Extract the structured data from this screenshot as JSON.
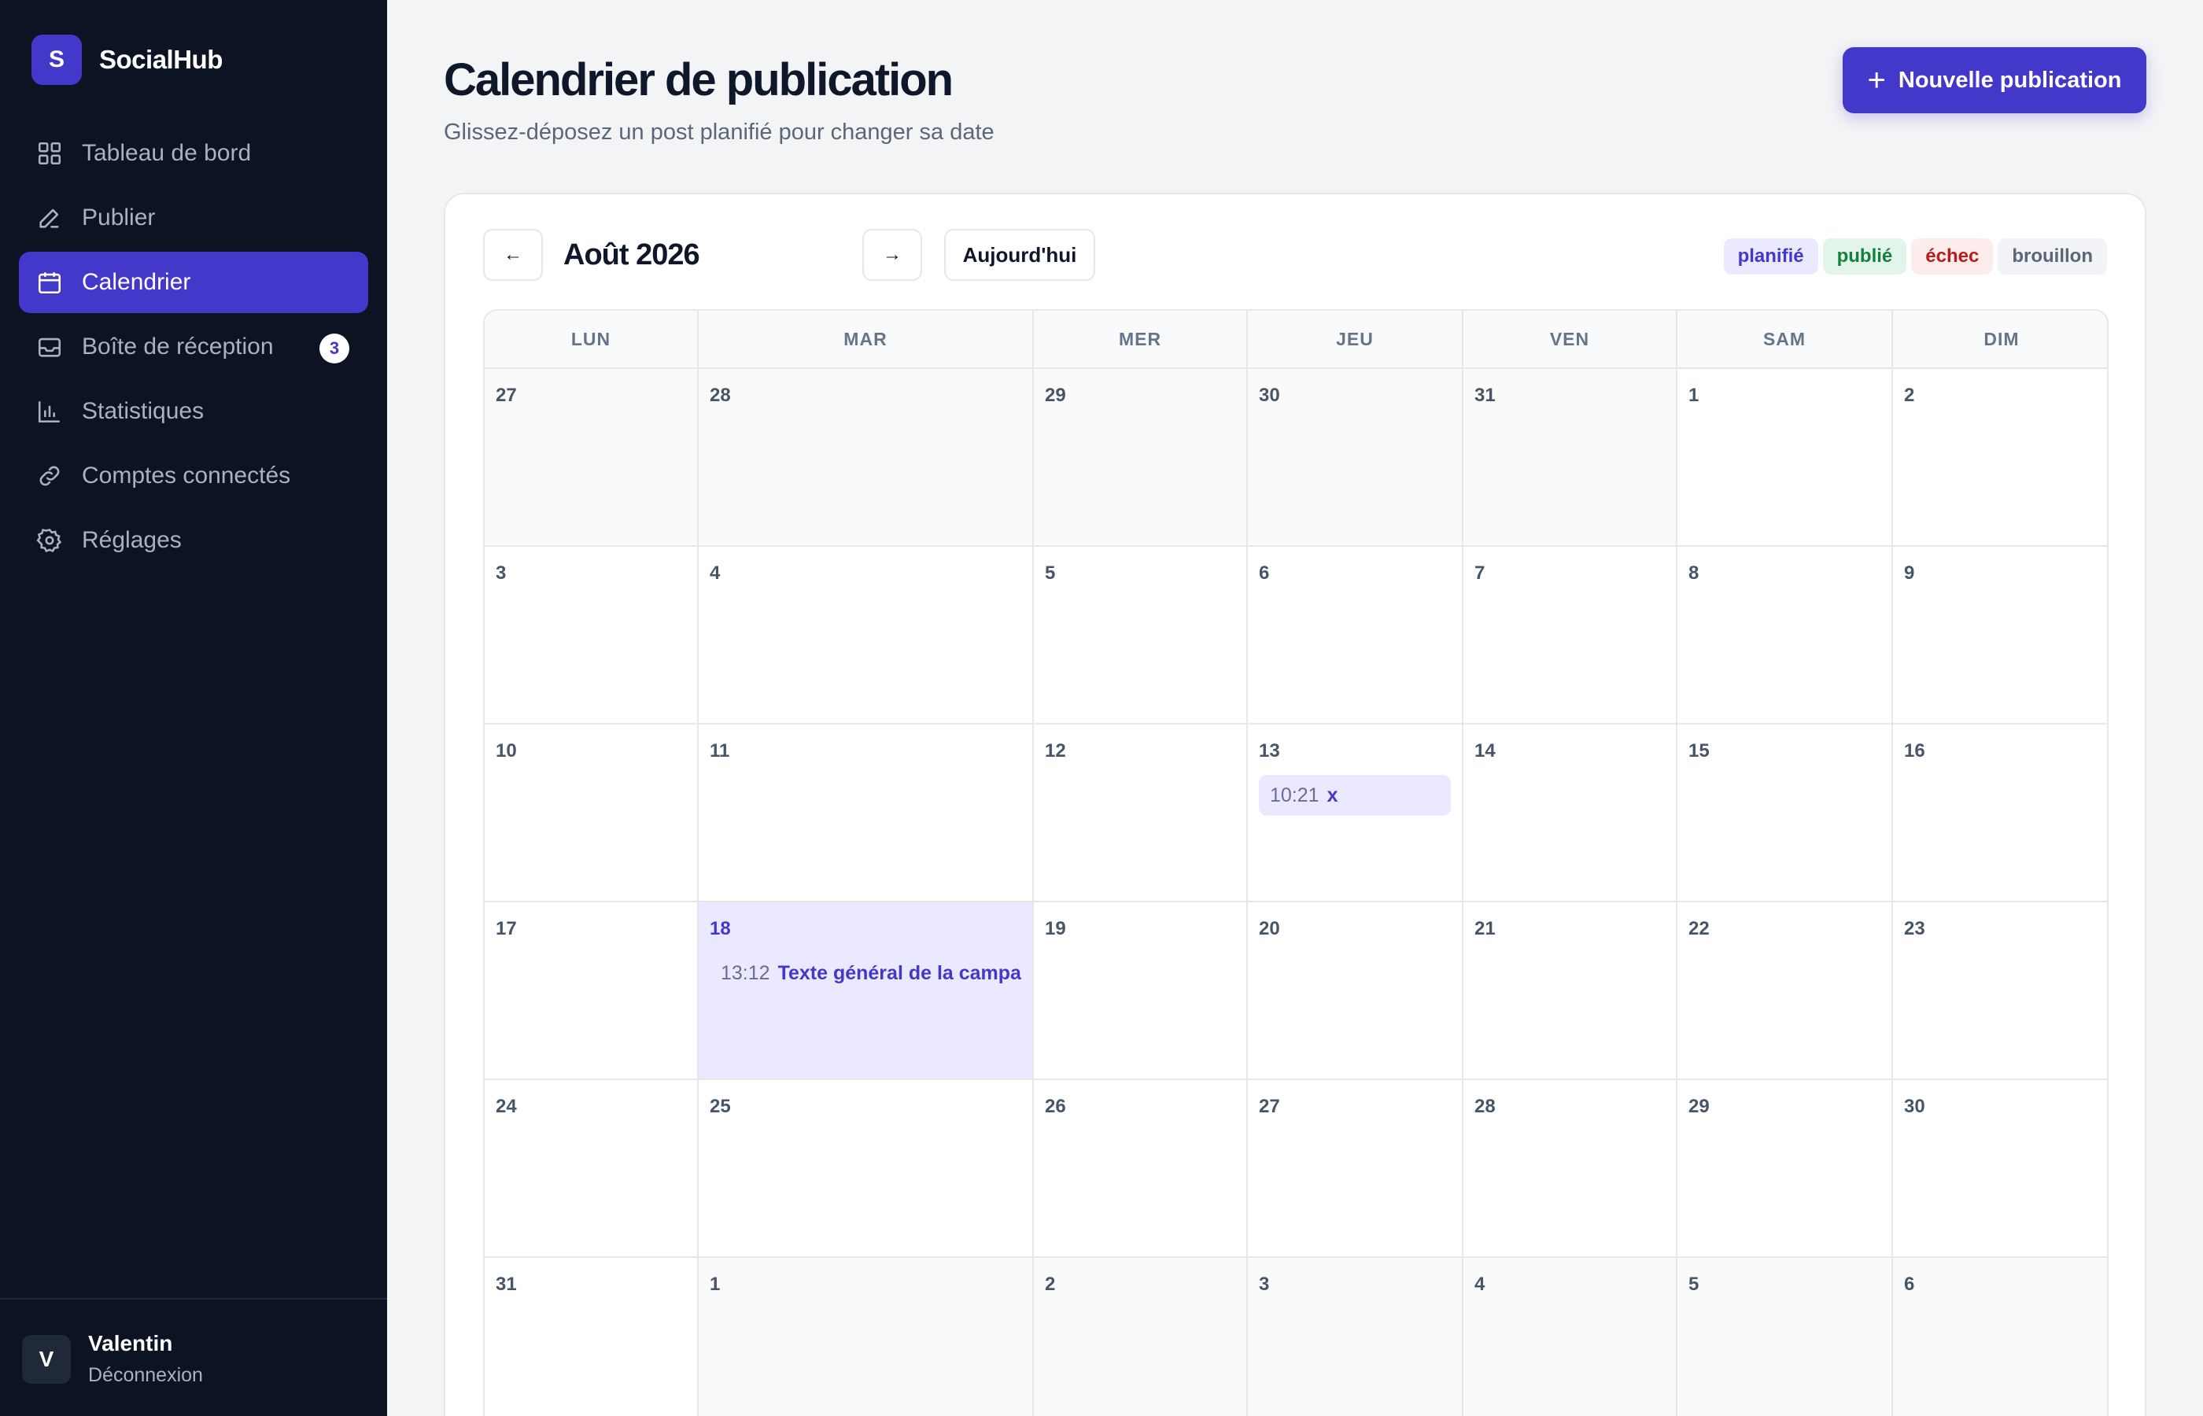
{
  "brand": {
    "logo_letter": "S",
    "name": "SocialHub"
  },
  "nav": [
    {
      "label": "Tableau de bord",
      "icon": "grid-icon"
    },
    {
      "label": "Publier",
      "icon": "pen-icon"
    },
    {
      "label": "Calendrier",
      "icon": "calendar-icon",
      "active": true
    },
    {
      "label": "Boîte de réception",
      "icon": "inbox-icon",
      "badge": "3"
    },
    {
      "label": "Statistiques",
      "icon": "bar-chart-icon"
    },
    {
      "label": "Comptes connectés",
      "icon": "link-icon"
    },
    {
      "label": "Réglages",
      "icon": "gear-icon"
    }
  ],
  "user": {
    "initial": "V",
    "name": "Valentin",
    "logout": "Déconnexion"
  },
  "header": {
    "title": "Calendrier de publication",
    "subtitle": "Glissez-déposez un post planifié pour changer sa date",
    "new_button": "Nouvelle publication"
  },
  "calendar": {
    "month": "Août 2026",
    "prev": "←",
    "next": "→",
    "today": "Aujourd'hui",
    "legend": [
      {
        "label": "planifié",
        "key": "plan"
      },
      {
        "label": "publié",
        "key": "pub"
      },
      {
        "label": "échec",
        "key": "fail"
      },
      {
        "label": "brouillon",
        "key": "draft"
      }
    ],
    "weekdays": [
      "LUN",
      "MAR",
      "MER",
      "JEU",
      "VEN",
      "SAM",
      "DIM"
    ],
    "weeks": [
      [
        {
          "d": "27",
          "out": true
        },
        {
          "d": "28",
          "out": true
        },
        {
          "d": "29",
          "out": true
        },
        {
          "d": "30",
          "out": true
        },
        {
          "d": "31",
          "out": true
        },
        {
          "d": "1"
        },
        {
          "d": "2"
        }
      ],
      [
        {
          "d": "3"
        },
        {
          "d": "4"
        },
        {
          "d": "5"
        },
        {
          "d": "6"
        },
        {
          "d": "7"
        },
        {
          "d": "8"
        },
        {
          "d": "9"
        }
      ],
      [
        {
          "d": "10"
        },
        {
          "d": "11"
        },
        {
          "d": "12"
        },
        {
          "d": "13",
          "events": [
            {
              "time": "10:21",
              "title": "x",
              "chip": true
            }
          ]
        },
        {
          "d": "14"
        },
        {
          "d": "15"
        },
        {
          "d": "16"
        }
      ],
      [
        {
          "d": "17"
        },
        {
          "d": "18",
          "today": true,
          "events": [
            {
              "time": "13:12",
              "title": "Texte général de la campag",
              "chip": false
            }
          ]
        },
        {
          "d": "19"
        },
        {
          "d": "20"
        },
        {
          "d": "21"
        },
        {
          "d": "22"
        },
        {
          "d": "23"
        }
      ],
      [
        {
          "d": "24"
        },
        {
          "d": "25"
        },
        {
          "d": "26"
        },
        {
          "d": "27"
        },
        {
          "d": "28"
        },
        {
          "d": "29"
        },
        {
          "d": "30"
        }
      ],
      [
        {
          "d": "31"
        },
        {
          "d": "1",
          "out": true
        },
        {
          "d": "2",
          "out": true
        },
        {
          "d": "3",
          "out": true
        },
        {
          "d": "4",
          "out": true
        },
        {
          "d": "5",
          "out": true
        },
        {
          "d": "6",
          "out": true
        }
      ]
    ]
  }
}
